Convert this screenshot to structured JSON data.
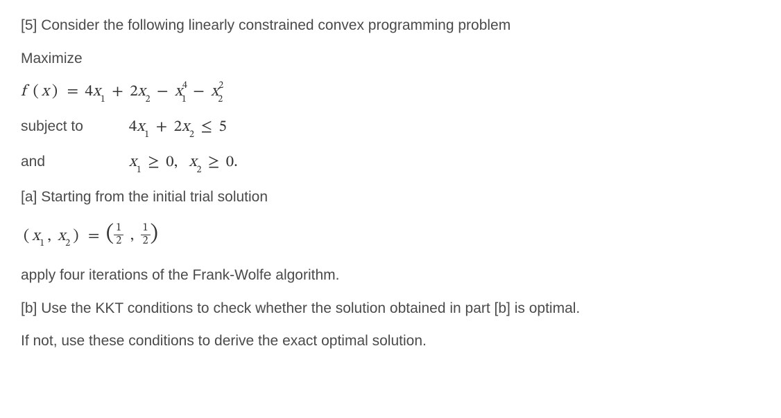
{
  "problem": {
    "number": "[5]",
    "intro": "Consider the following linearly constrained convex programming problem",
    "maximize_label": "Maximize",
    "objective": {
      "lhs_f": "f",
      "lhs_x": "x",
      "eq": "=",
      "terms": [
        "4",
        "x",
        "1",
        "+",
        "2",
        "x",
        "2",
        "−",
        "x",
        "1",
        "4",
        "−",
        "x",
        "2",
        "2"
      ]
    },
    "subject_to_label": "subject to",
    "constraint1": {
      "terms": [
        "4",
        "x",
        "1",
        "+",
        "2",
        "x",
        "2",
        "≤",
        "5"
      ]
    },
    "and_label": "and",
    "constraint2": {
      "x1": "x",
      "s1": "1",
      "ge1": "≥",
      "z1": "0,",
      "x2": "x",
      "s2": "2",
      "ge2": "≥",
      "z2": "0."
    },
    "part_a": {
      "label": "[a]",
      "text1": "Starting from the initial trial solution",
      "initial": {
        "x": "x",
        "s1": "1",
        "comma1": ",",
        "x2": "x",
        "s2": "2",
        "eq": "=",
        "frac1_top": "1",
        "frac1_bot": "2",
        "comma2": ",",
        "frac2_top": "1",
        "frac2_bot": "2"
      },
      "text2": "apply four iterations of the Frank-Wolfe algorithm."
    },
    "part_b": {
      "label": "[b]",
      "text1": "Use the KKT conditions to check whether the solution obtained in part [b] is optimal.",
      "text2": "If not, use these conditions to derive the exact optimal solution."
    }
  }
}
